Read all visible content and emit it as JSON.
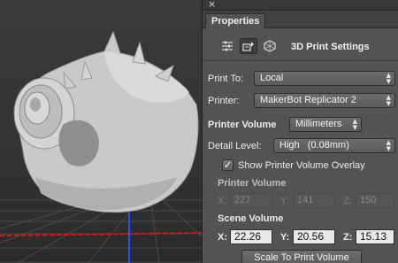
{
  "panel": {
    "close_glyph": "×",
    "tab_label": "Properties",
    "mode_title": "3D Print Settings",
    "mode_icons": [
      "scene-filter-icon",
      "print-settings-icon",
      "mesh-icon"
    ]
  },
  "print_to": {
    "label": "Print To:",
    "value": "Local"
  },
  "printer": {
    "label": "Printer:",
    "value": "MakerBot Replicator 2"
  },
  "printer_volume_units": {
    "label": "Printer Volume",
    "value": "Millimeters"
  },
  "detail_level": {
    "label": "Detail Level:",
    "value": "High   (0.08mm)"
  },
  "overlay": {
    "label": "Show Printer Volume Overlay",
    "checked": true,
    "check_glyph": "✓"
  },
  "printer_volume": {
    "heading": "Printer Volume",
    "x_label": "X:",
    "x": "227",
    "y_label": "Y:",
    "y": "141",
    "z_label": "Z:",
    "z": "150"
  },
  "scene_volume": {
    "heading": "Scene Volume",
    "x_label": "X:",
    "x": "22.26",
    "y_label": "Y:",
    "y": "20.56",
    "z_label": "Z:",
    "z": "15.13"
  },
  "scale_button": "Scale To Print Volume",
  "colors": {
    "panel_bg": "#535353",
    "axis_x": "#d01818",
    "axis_y": "#2244ff",
    "model": "#cfcfcf"
  }
}
